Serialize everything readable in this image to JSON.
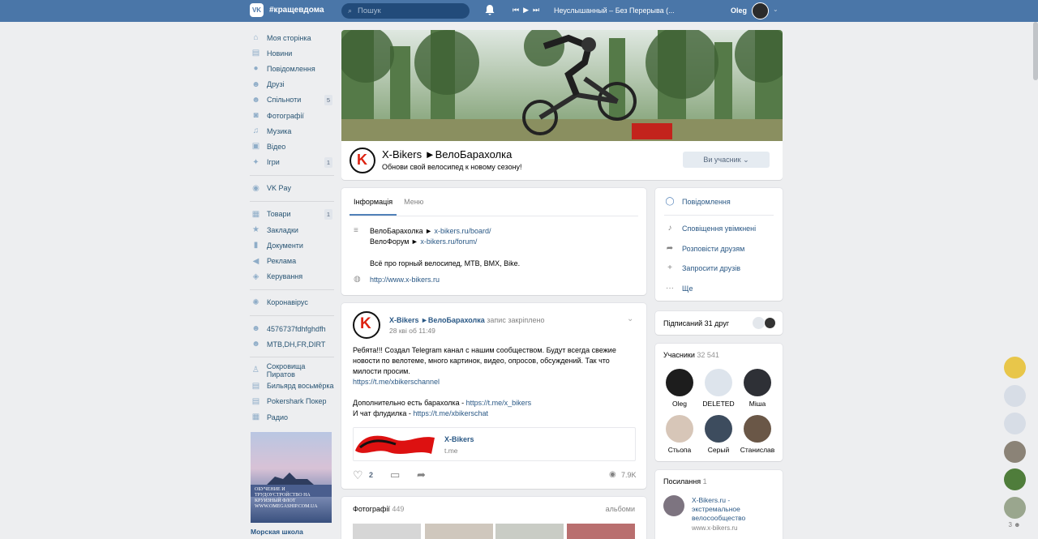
{
  "topbar": {
    "logo": "VK",
    "brand": "#кращевдома",
    "search_placeholder": "Пошук",
    "track": "Неуслышанный – Без Перерыва (...",
    "user_name": "Oleg"
  },
  "sidebar": {
    "items": [
      {
        "label": "Моя сторінка",
        "icon": "home-icon"
      },
      {
        "label": "Новини",
        "icon": "news-icon"
      },
      {
        "label": "Повідомлення",
        "icon": "messages-icon"
      },
      {
        "label": "Друзі",
        "icon": "friends-icon"
      },
      {
        "label": "Спільноти",
        "icon": "groups-icon",
        "count": "5"
      },
      {
        "label": "Фотографії",
        "icon": "camera-icon"
      },
      {
        "label": "Музика",
        "icon": "music-icon"
      },
      {
        "label": "Відео",
        "icon": "video-icon"
      },
      {
        "label": "Ігри",
        "icon": "games-icon",
        "count": "1"
      }
    ],
    "pay": "VK Pay",
    "items2": [
      {
        "label": "Товари",
        "icon": "shop-icon",
        "count": "1"
      },
      {
        "label": "Закладки",
        "icon": "bookmark-icon"
      },
      {
        "label": "Документи",
        "icon": "document-icon"
      },
      {
        "label": "Реклама",
        "icon": "ads-icon"
      },
      {
        "label": "Керування",
        "icon": "gamepad-icon"
      }
    ],
    "corona": "Коронавірус",
    "apps": [
      "4576737fdhfghdfh",
      "MTB,DH,FR,DIRT"
    ],
    "games": [
      "Сокровища Пиратов",
      "Бильярд восьмёрка",
      "Pokershark Покер",
      "Радио"
    ],
    "ad_image_text": "ОБУЧЕНИЕ И ТРУДОУСТРОЙСТВО НА КРУИЗНЫЙ ФЛОТ WWW.OMEGASHIP.COM.UA",
    "ad_title": "Морская школа"
  },
  "group": {
    "name": "X-Bikers ►ВелоБарахолка",
    "status": "Обнови свой велосипед к новому сезону!",
    "member_button": "Ви учасник"
  },
  "info": {
    "tabs": [
      "Інформація",
      "Меню"
    ],
    "line1_text": "ВелоБарахолка ► ",
    "line1_link": "x-bikers.ru/board/",
    "line2_text": "ВелоФорум ► ",
    "line2_link": "x-bikers.ru/forum/",
    "line3": "Всё про горный велосипед, MTB, BMX, Bike.",
    "website": "http://www.x-bikers.ru"
  },
  "post": {
    "author": "X-Bikers ►ВелоБарахолка",
    "pinned": " запис закріплено",
    "date": "28 кві об 11:49",
    "p1": "Ребята!!! Создал Telegram канал с нашим сообществом. Будут всегда свежие новости по велотеме, много картинок, видео, опросов, обсуждений. Так что милости просим.",
    "p1_link": "https://t.me/xbikerschannel",
    "p2_text": "Дополнительно есть барахолка - ",
    "p2_link": "https://t.me/x_bikers",
    "p3_text": "И чат флудилка - ",
    "p3_link": "https://t.me/xbikerschat",
    "snippet_title": "X-Bikers",
    "snippet_source": "t.me",
    "likes": "2",
    "views": "7.9K"
  },
  "photos": {
    "title": "Фотографії",
    "count": "449",
    "albums": "альбоми"
  },
  "actions": {
    "message": "Повідомлення",
    "notify": "Сповіщення увімкнені",
    "share": "Розповісти друзям",
    "invite": "Запросити друзів",
    "more": "Ще"
  },
  "friends": {
    "label": "Підписаний 31 друг"
  },
  "members": {
    "title": "Учасники",
    "count": "32 541",
    "list": [
      "Oleg",
      "DELETED",
      "Міша",
      "Стьопа",
      "Серый",
      "Станислав"
    ]
  },
  "links": {
    "title": "Посилання",
    "count": "1",
    "name": "X-Bikers.ru - экстремальное велосообщество",
    "url": "www.x-bikers.ru"
  },
  "online_count": "3"
}
